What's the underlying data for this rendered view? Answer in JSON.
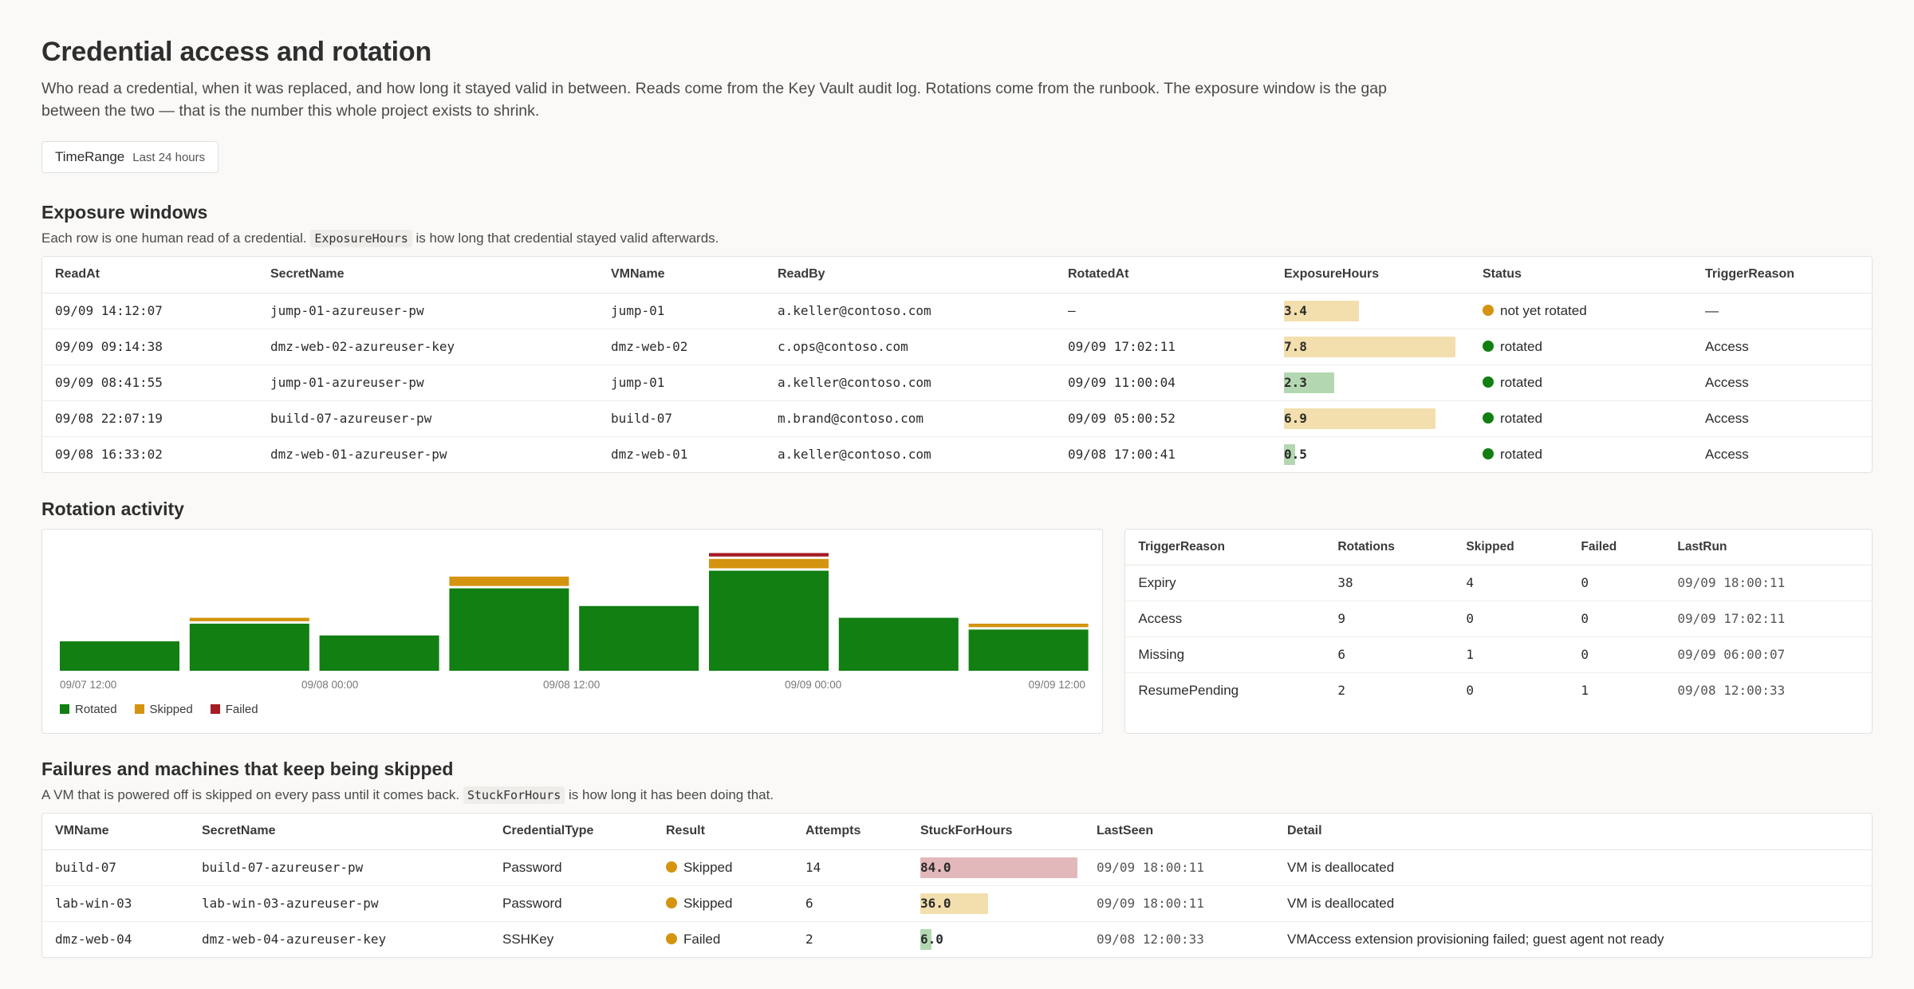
{
  "header": {
    "title": "Credential access and rotation",
    "description": "Who read a credential, when it was replaced, and how long it stayed valid in between. Reads come from the Key Vault audit log. Rotations come from the runbook. The exposure window is the gap between the two — that is the number this whole project exists to shrink."
  },
  "parameter": {
    "name": "TimeRange",
    "value": "Last 24 hours"
  },
  "colors": {
    "rotated": "#117f12",
    "skipped": "#d4940f",
    "failed": "#a51c25",
    "bar_amber": "#f3dfae",
    "bar_green": "#b3d8b1",
    "bar_red": "#e3b8ba"
  },
  "exposure": {
    "title": "Exposure windows",
    "sub_prefix": "Each row is one human read of a credential.",
    "sub_code": "ExposureHours",
    "sub_suffix": "is how long that credential stayed valid afterwards.",
    "columns": [
      "ReadAt",
      "SecretName",
      "VMName",
      "ReadBy",
      "RotatedAt",
      "ExposureHours",
      "Status",
      "TriggerReason"
    ],
    "rows": [
      {
        "read_at": "09/09 14:12:07",
        "secret": "jump-01-azureuser-pw",
        "vm": "jump-01",
        "read_by": "a.keller@contoso.com",
        "rotated_at": "–",
        "hours": "3.4",
        "hours_val": 3.4,
        "bar": "amber",
        "status": "not yet rotated",
        "status_color": "skipped",
        "trigger": "—"
      },
      {
        "read_at": "09/09 09:14:38",
        "secret": "dmz-web-02-azureuser-key",
        "vm": "dmz-web-02",
        "read_by": "c.ops@contoso.com",
        "rotated_at": "09/09 17:02:11",
        "hours": "7.8",
        "hours_val": 7.8,
        "bar": "amber",
        "status": "rotated",
        "status_color": "rotated",
        "trigger": "Access"
      },
      {
        "read_at": "09/09 08:41:55",
        "secret": "jump-01-azureuser-pw",
        "vm": "jump-01",
        "read_by": "a.keller@contoso.com",
        "rotated_at": "09/09 11:00:04",
        "hours": "2.3",
        "hours_val": 2.3,
        "bar": "green",
        "status": "rotated",
        "status_color": "rotated",
        "trigger": "Access"
      },
      {
        "read_at": "09/08 22:07:19",
        "secret": "build-07-azureuser-pw",
        "vm": "build-07",
        "read_by": "m.brand@contoso.com",
        "rotated_at": "09/09 05:00:52",
        "hours": "6.9",
        "hours_val": 6.9,
        "bar": "amber",
        "status": "rotated",
        "status_color": "rotated",
        "trigger": "Access"
      },
      {
        "read_at": "09/08 16:33:02",
        "secret": "dmz-web-01-azureuser-pw",
        "vm": "dmz-web-01",
        "read_by": "a.keller@contoso.com",
        "rotated_at": "09/08 17:00:41",
        "hours": "0.5",
        "hours_val": 0.5,
        "bar": "green",
        "status": "rotated",
        "status_color": "rotated",
        "trigger": "Access"
      }
    ]
  },
  "rotation": {
    "title": "Rotation activity",
    "legend": [
      {
        "label": "Rotated",
        "color": "rotated"
      },
      {
        "label": "Skipped",
        "color": "skipped"
      },
      {
        "label": "Failed",
        "color": "failed"
      }
    ],
    "summary_columns": [
      "TriggerReason",
      "Rotations",
      "Skipped",
      "Failed",
      "LastRun"
    ],
    "summary_rows": [
      {
        "reason": "Expiry",
        "rotations": "38",
        "skipped": "4",
        "failed": "0",
        "last_run": "09/09 18:00:11"
      },
      {
        "reason": "Access",
        "rotations": "9",
        "skipped": "0",
        "failed": "0",
        "last_run": "09/09 17:02:11"
      },
      {
        "reason": "Missing",
        "rotations": "6",
        "skipped": "1",
        "failed": "0",
        "last_run": "09/09 06:00:07"
      },
      {
        "reason": "ResumePending",
        "rotations": "2",
        "skipped": "0",
        "failed": "1",
        "last_run": "09/08 12:00:33"
      }
    ]
  },
  "chart_data": {
    "type": "bar",
    "stacked": true,
    "categories": [
      "09/07 12:00",
      "09/07 18:00",
      "09/08 00:00",
      "09/08 06:00",
      "09/08 12:00",
      "09/08 18:00",
      "09/09 00:00",
      "09/09 06:00",
      "09/09 12:00"
    ],
    "x_tick_labels": [
      "09/07 12:00",
      "09/08 00:00",
      "09/08 12:00",
      "09/09 00:00",
      "09/09 12:00"
    ],
    "series": [
      {
        "name": "Rotated",
        "values": [
          5,
          8,
          6,
          14,
          11,
          17,
          9,
          7
        ]
      },
      {
        "name": "Skipped",
        "values": [
          0,
          1,
          0,
          2,
          0,
          2,
          0,
          1
        ]
      },
      {
        "name": "Failed",
        "values": [
          0,
          0,
          0,
          0,
          0,
          1,
          0,
          0
        ]
      }
    ],
    "ylim": [
      0,
      20
    ],
    "grid": false,
    "legend_position": "bottom-left"
  },
  "failures": {
    "title": "Failures and machines that keep being skipped",
    "sub_prefix": "A VM that is powered off is skipped on every pass until it comes back.",
    "sub_code": "StuckForHours",
    "sub_suffix": "is how long it has been doing that.",
    "columns": [
      "VMName",
      "SecretName",
      "CredentialType",
      "Result",
      "Attempts",
      "StuckForHours",
      "LastSeen",
      "Detail"
    ],
    "rows": [
      {
        "vm": "build-07",
        "secret": "build-07-azureuser-pw",
        "type": "Password",
        "result": "Skipped",
        "attempts": "14",
        "stuck": "84.0",
        "stuck_val": 84.0,
        "bar": "red",
        "last_seen": "09/09 18:00:11",
        "detail": "VM is deallocated"
      },
      {
        "vm": "lab-win-03",
        "secret": "lab-win-03-azureuser-pw",
        "type": "Password",
        "result": "Skipped",
        "attempts": "6",
        "stuck": "36.0",
        "stuck_val": 36.0,
        "bar": "amber",
        "last_seen": "09/09 18:00:11",
        "detail": "VM is deallocated"
      },
      {
        "vm": "dmz-web-04",
        "secret": "dmz-web-04-azureuser-key",
        "type": "SSHKey",
        "result": "Failed",
        "attempts": "2",
        "stuck": "6.0",
        "stuck_val": 6.0,
        "bar": "green",
        "last_seen": "09/08 12:00:33",
        "detail": "VMAccess extension provisioning failed; guest agent not ready"
      }
    ]
  }
}
